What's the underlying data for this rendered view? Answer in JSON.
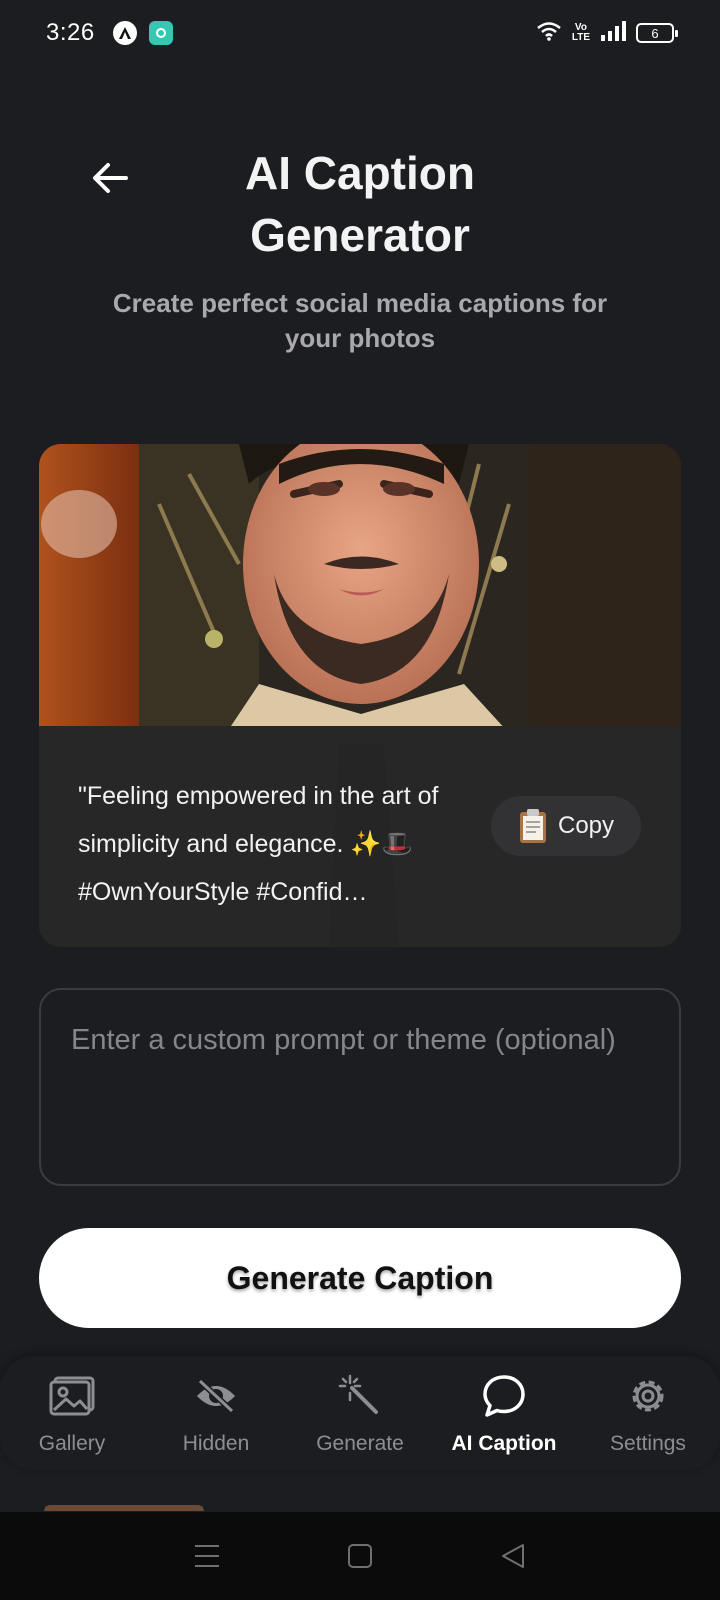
{
  "status_bar": {
    "time": "3:26",
    "network_label_top": "Vo",
    "network_label_bottom": "LTE",
    "battery_level": "6"
  },
  "header": {
    "title": "AI Caption Generator",
    "subtitle": "Create perfect social media captions for your photos"
  },
  "caption_card": {
    "caption_text": "\"Feeling empowered in the art of simplicity and elegance. ✨🎩 #OwnYourStyle #Confid…",
    "copy_icon": "clipboard-icon",
    "copy_label": "Copy"
  },
  "prompt": {
    "value": "",
    "placeholder": "Enter a custom prompt or theme (optional)"
  },
  "generate_button": {
    "label": "Generate Caption"
  },
  "bottom_nav": {
    "active": "AI Caption",
    "items": [
      {
        "label": "Gallery",
        "icon": "image-icon"
      },
      {
        "label": "Hidden",
        "icon": "eye-off-icon"
      },
      {
        "label": "Generate",
        "icon": "magic-wand-icon"
      },
      {
        "label": "AI Caption",
        "icon": "chat-bubble-icon"
      },
      {
        "label": "Settings",
        "icon": "gear-icon"
      }
    ]
  },
  "system_nav": {
    "icons": [
      "menu-icon",
      "home-icon",
      "back-triangle-icon"
    ]
  },
  "colors": {
    "background": "#1c1d20",
    "text_primary": "#f3f3f3",
    "text_secondary": "#a9a9ad",
    "inactive_nav": "#8d8e92",
    "button_bg": "#ffffff"
  }
}
